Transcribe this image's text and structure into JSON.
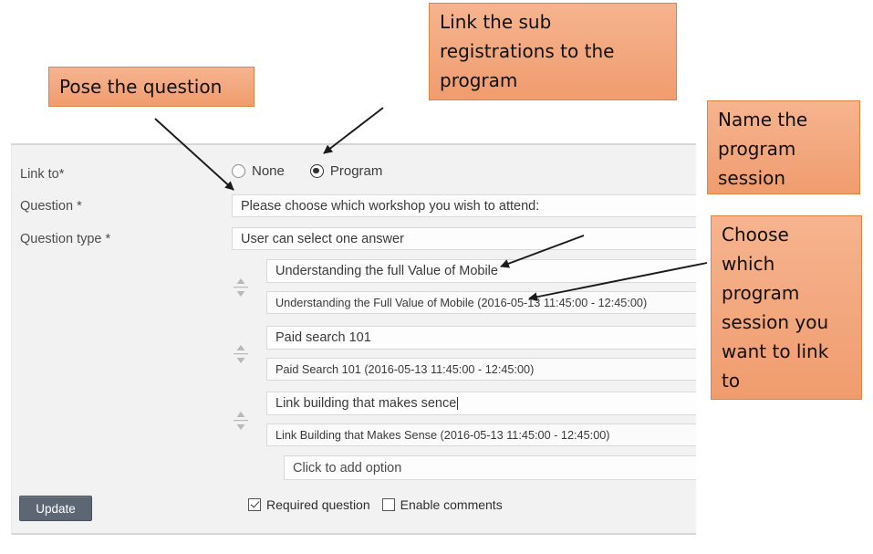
{
  "annotations": [
    {
      "id": "pose-question",
      "text": "Pose the question"
    },
    {
      "id": "link-sub-reg",
      "text": "Link the sub\nregistrations to the\nprogram"
    },
    {
      "id": "name-session",
      "text": "Name the\nprogram\nsession"
    },
    {
      "id": "choose-session",
      "text": "Choose\nwhich\nprogram\nsession you\nwant to link\nto"
    }
  ],
  "colors": {
    "callout_fill_top": "#f6b48f",
    "callout_fill_bottom": "#f09c6e",
    "callout_border": "#e0833f",
    "button_bg": "#5d6774",
    "panel_bg": "#f2f2f2",
    "input_bg": "#fdfdfd"
  },
  "form": {
    "labels": {
      "link_to": "Link to*",
      "question": "Question *",
      "question_type": "Question type *"
    },
    "link_to": {
      "options": [
        {
          "label": "None",
          "selected": false
        },
        {
          "label": "Program",
          "selected": true
        }
      ]
    },
    "question_value": "Please choose which workshop you wish to attend:",
    "question_type_value": "User can select one answer",
    "options": [
      {
        "option_text": "Understanding the full Value of Mobile",
        "session": "Understanding the Full Value of Mobile (2016-05-13 11:45:00 - 12:45:00)",
        "has_caret": false
      },
      {
        "option_text": "Paid search 101",
        "session": "Paid Search 101 (2016-05-13 11:45:00 - 12:45:00)",
        "has_caret": false
      },
      {
        "option_text": "Link building that makes sence",
        "session": "Link Building that Makes Sense (2016-05-13 11:45:00 - 12:45:00)",
        "has_caret": true
      }
    ],
    "add_option_placeholder": "Click to add option",
    "update_label": "Update",
    "checkboxes": [
      {
        "label": "Required question",
        "checked": true
      },
      {
        "label": "Enable comments",
        "checked": false
      }
    ]
  }
}
